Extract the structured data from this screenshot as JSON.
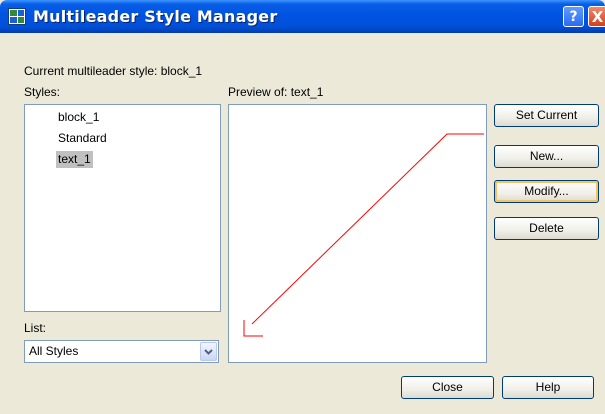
{
  "window": {
    "title": "Multileader Style Manager",
    "help_glyph": "?",
    "close_glyph": "X"
  },
  "current_style": {
    "label": "Current multileader style: block_1"
  },
  "styles": {
    "label": "Styles:",
    "items": [
      {
        "label": "block_1",
        "selected": false
      },
      {
        "label": "Standard",
        "selected": false
      },
      {
        "label": "text_1",
        "selected": true
      }
    ]
  },
  "preview": {
    "label": "Preview of: text_1",
    "leader_color": "#ff0000"
  },
  "list": {
    "label": "List:",
    "selected_value": "All Styles"
  },
  "buttons": {
    "set_current": "Set Current",
    "new": "New...",
    "modify": "Modify...",
    "delete": "Delete",
    "close": "Close",
    "help": "Help"
  },
  "icons": {
    "app": "multileader-style-icon",
    "dropdown": "chevron-down-icon"
  }
}
